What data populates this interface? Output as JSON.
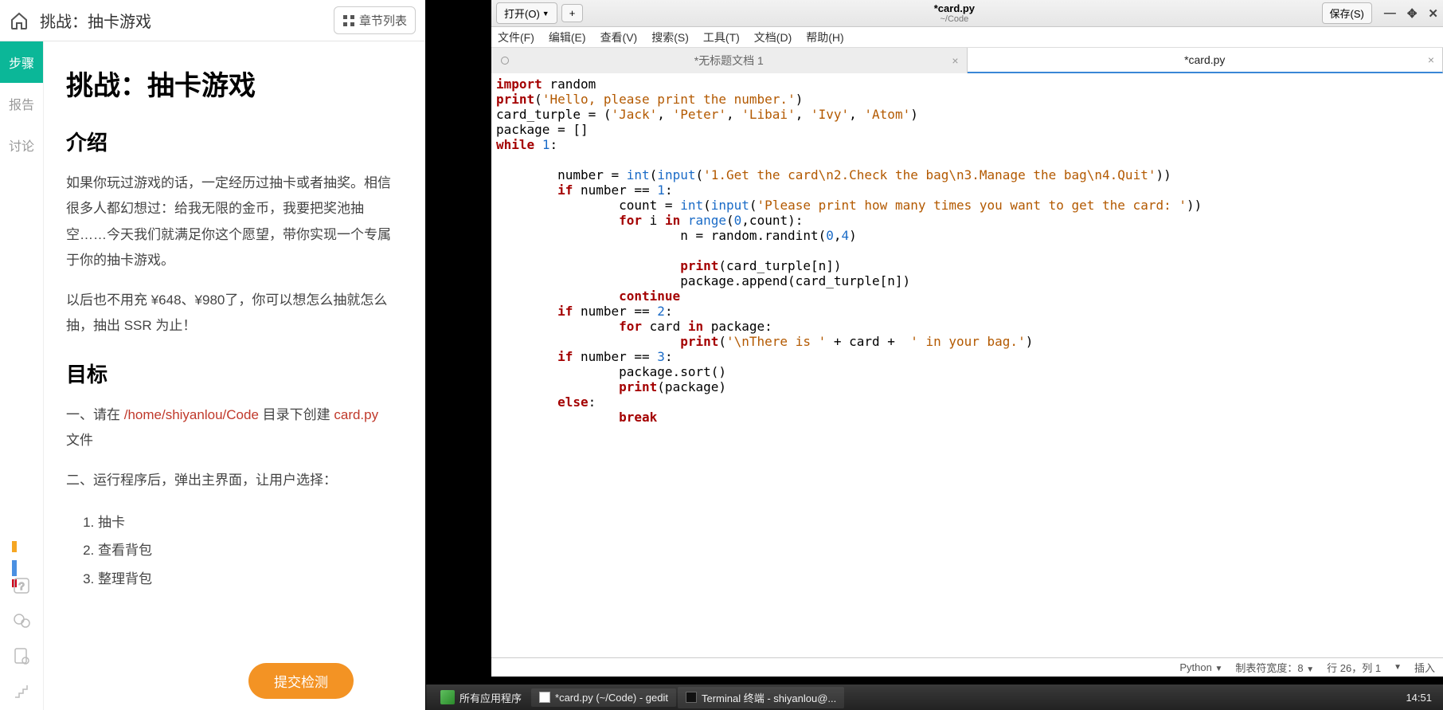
{
  "left": {
    "breadcrumb": "挑战：抽卡游戏",
    "chapter_btn": "章节列表",
    "rail": {
      "steps": "步骤",
      "report": "报告",
      "discuss": "讨论"
    },
    "article": {
      "h1": "挑战：抽卡游戏",
      "intro_h": "介绍",
      "intro_p1": "如果你玩过游戏的话，一定经历过抽卡或者抽奖。相信很多人都幻想过：给我无限的金币，我要把奖池抽空……今天我们就满足你这个愿望，带你实现一个专属于你的抽卡游戏。",
      "intro_p2": "以后也不用充 ¥648、¥980了，你可以想怎么抽就怎么抽，抽出 SSR 为止！",
      "goal_h": "目标",
      "goal_p1a": "一、请在 ",
      "goal_p1_path": "/home/shiyanlou/Code",
      "goal_p1b": " 目录下创建 ",
      "goal_p1_file": "card.py",
      "goal_p1c": " 文件",
      "goal_p2": "二、运行程序后，弹出主界面，让用户选择：",
      "opts": [
        "抽卡",
        "查看背包",
        "整理背包"
      ]
    },
    "submit": "提交检测"
  },
  "gedit": {
    "open": "打开(O)",
    "plus": "+",
    "save": "保存(S)",
    "title": "*card.py",
    "subtitle": "~/Code",
    "menu": [
      "文件(F)",
      "编辑(E)",
      "查看(V)",
      "搜索(S)",
      "工具(T)",
      "文档(D)",
      "帮助(H)"
    ],
    "tabs": [
      {
        "label": "*无标题文档 1",
        "active": false
      },
      {
        "label": "*card.py",
        "active": true
      }
    ],
    "code": {
      "l1a": "import",
      "l1b": " random",
      "l2a": "print",
      "l2b": "(",
      "l2c": "'Hello, please print the number.'",
      "l2d": ")",
      "l3a": "card_turple = (",
      "l3b": "'Jack'",
      "l3c": ", ",
      "l3d": "'Peter'",
      "l3e": ", ",
      "l3f": "'Libai'",
      "l3g": ", ",
      "l3h": "'Ivy'",
      "l3i": ", ",
      "l3j": "'Atom'",
      "l3k": ")",
      "l4": "package = []",
      "l5a": "while",
      "l5b": " ",
      "l5c": "1",
      "l5d": ":",
      "l7a": "        number = ",
      "l7b": "int",
      "l7c": "(",
      "l7d": "input",
      "l7e": "(",
      "l7f": "'1.Get the card\\n2.Check the bag\\n3.Manage the bag\\n4.Quit'",
      "l7g": "))",
      "l8a": "        ",
      "l8b": "if",
      "l8c": " number == ",
      "l8d": "1",
      "l8e": ":",
      "l9a": "                count = ",
      "l9b": "int",
      "l9c": "(",
      "l9d": "input",
      "l9e": "(",
      "l9f": "'Please print how many times you want to get the card: '",
      "l9g": "))",
      "l10a": "                ",
      "l10b": "for",
      "l10c": " i ",
      "l10d": "in",
      "l10e": " ",
      "l10f": "range",
      "l10g": "(",
      "l10h": "0",
      "l10i": ",count):",
      "l11a": "                        n = random.randint(",
      "l11b": "0",
      "l11c": ",",
      "l11d": "4",
      "l11e": ")",
      "l13a": "                        ",
      "l13b": "print",
      "l13c": "(card_turple[n])",
      "l14": "                        package.append(card_turple[n])",
      "l15a": "                ",
      "l15b": "continue",
      "l16a": "        ",
      "l16b": "if",
      "l16c": " number == ",
      "l16d": "2",
      "l16e": ":",
      "l17a": "                ",
      "l17b": "for",
      "l17c": " card ",
      "l17d": "in",
      "l17e": " package:",
      "l18a": "                        ",
      "l18b": "print",
      "l18c": "(",
      "l18d": "'\\nThere is '",
      "l18e": " + card +  ",
      "l18f": "' in your bag.'",
      "l18g": ")",
      "l19a": "        ",
      "l19b": "if",
      "l19c": " number == ",
      "l19d": "3",
      "l19e": ":",
      "l20": "                package.sort()",
      "l21a": "                ",
      "l21b": "print",
      "l21c": "(package)",
      "l22a": "        ",
      "l22b": "else",
      "l22c": ":",
      "l23a": "                ",
      "l23b": "break"
    },
    "status": {
      "lang": "Python",
      "tabwidth": "制表符宽度：8",
      "pos": "行 26，列 1",
      "ins": "插入"
    }
  },
  "taskbar": {
    "apps": "所有应用程序",
    "t1": "*card.py (~/Code) - gedit",
    "t2": "Terminal 终端 - shiyanlou@...",
    "clock": "14:51"
  }
}
